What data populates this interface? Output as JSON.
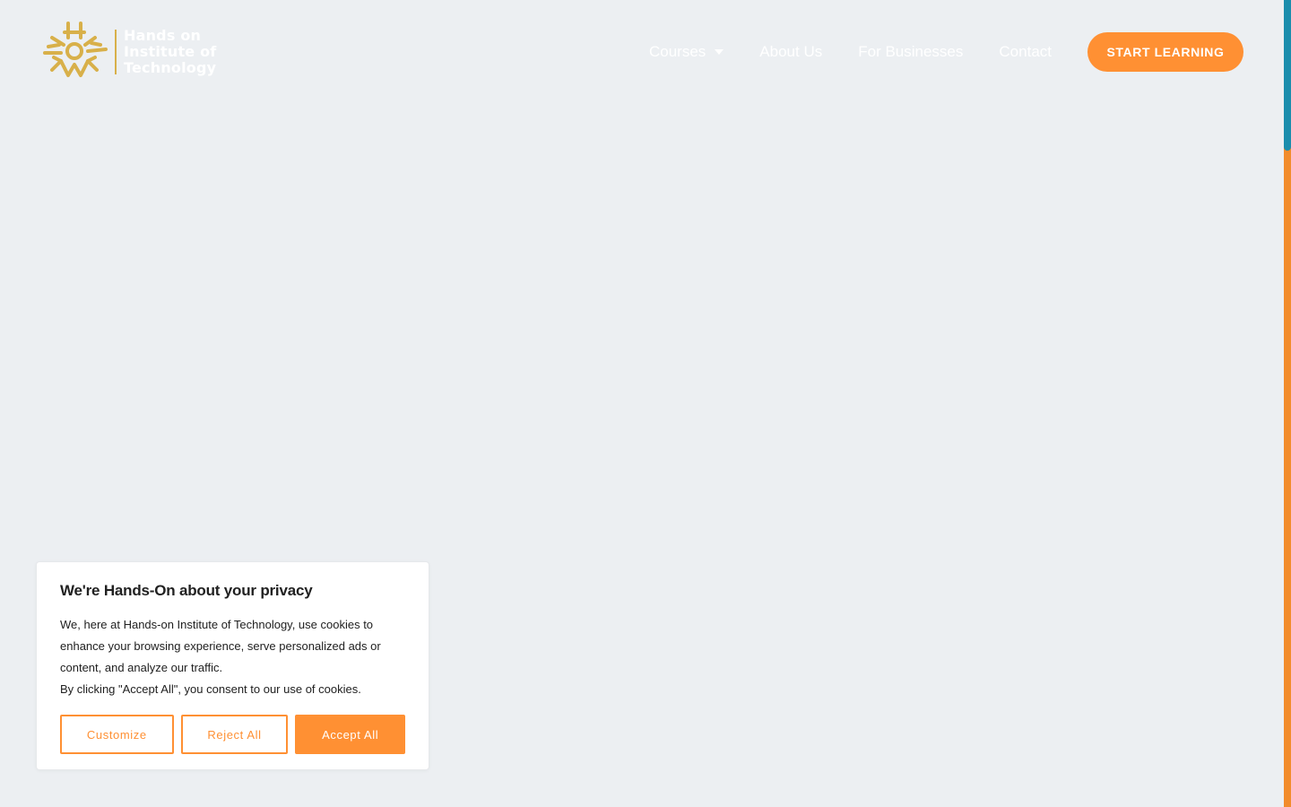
{
  "colors": {
    "accent": "#ff9033",
    "logo_gold": "#d8b04a",
    "background": "#eceff2",
    "scroll_thumb": "#1b8dad"
  },
  "header": {
    "logo": {
      "icon": "sun-gear-logo-icon",
      "lines": [
        "Hands on",
        "Institute of",
        "Technology"
      ]
    },
    "nav": {
      "courses": "Courses",
      "about": "About Us",
      "businesses": "For Businesses",
      "contact": "Contact"
    },
    "cta_label": "START LEARNING"
  },
  "cookie_banner": {
    "title": "We're Hands-On about your privacy",
    "text_line1": "We, here at Hands-on Institute of Technology, use cookies to enhance your browsing experience, serve personalized ads or content, and analyze our traffic.",
    "text_line2": "By clicking \"Accept All\", you consent to our use of cookies.",
    "buttons": {
      "customize": "Customize",
      "reject": "Reject All",
      "accept": "Accept All"
    }
  }
}
